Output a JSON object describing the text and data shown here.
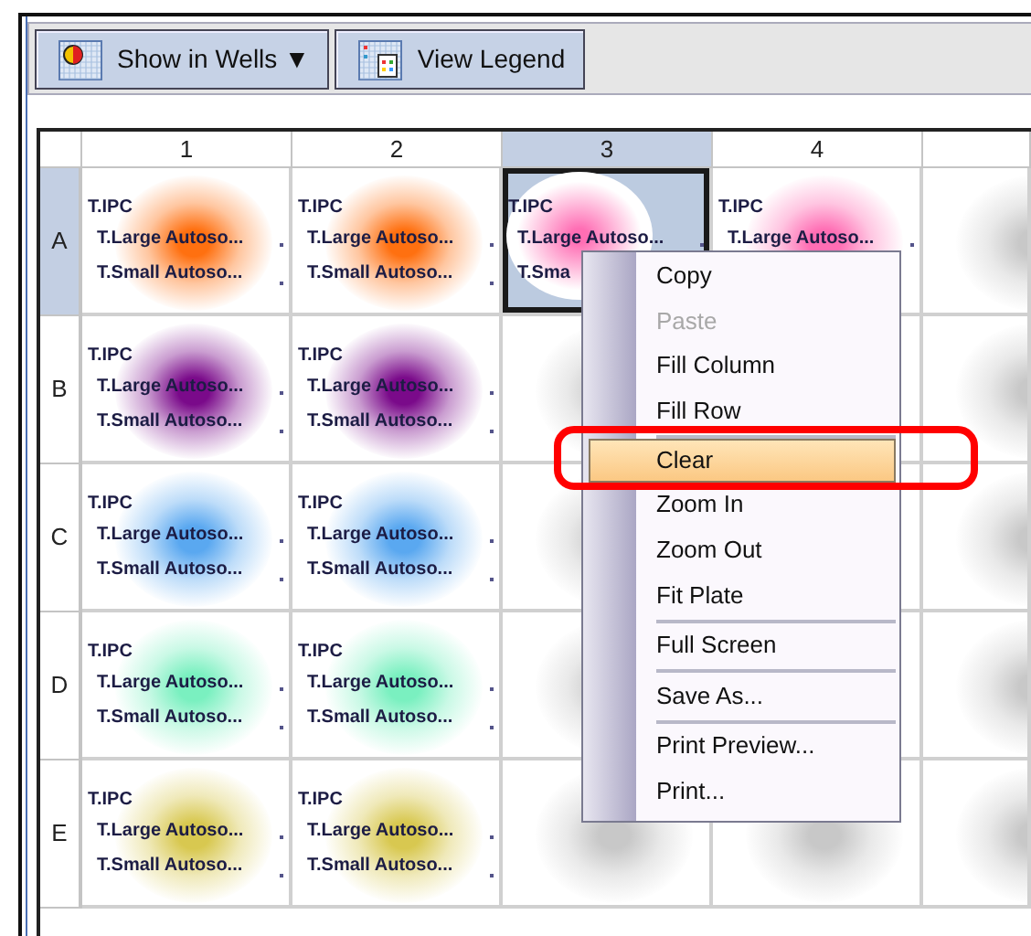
{
  "toolbar": {
    "buttons": [
      {
        "kind": "dropdown",
        "label": "Show in Wells",
        "caret": "▼"
      },
      {
        "kind": "legend",
        "label": "View Legend"
      }
    ]
  },
  "plate": {
    "columns": [
      {
        "label": "1",
        "selected": false
      },
      {
        "label": "2",
        "selected": false
      },
      {
        "label": "3",
        "selected": true
      },
      {
        "label": "4",
        "selected": false
      },
      {
        "selected": false
      }
    ],
    "rows": [
      {
        "label": "A",
        "selected": true,
        "wells": [
          {
            "color": "#ff7010",
            "selected": false,
            "lines": [
              "T.IPC",
              "T.Large Autoso...",
              "T.Small Autoso..."
            ]
          },
          {
            "color": "#ff7010",
            "selected": false,
            "lines": [
              "T.IPC",
              "T.Large Autoso...",
              "T.Small Autoso..."
            ]
          },
          {
            "color": "#ff6eb4",
            "selected": true,
            "lines": [
              "T.IPC",
              "T.Large Autoso...",
              "T.Sma"
            ]
          },
          {
            "color": "#ff6eb4",
            "selected": false,
            "lines": [
              "T.IPC",
              "T.Large Autoso..."
            ]
          },
          {
            "color": "#c8c8c8",
            "selected": false
          }
        ]
      },
      {
        "label": "B",
        "selected": false,
        "wells": [
          {
            "color": "#7a0a8a",
            "selected": false,
            "lines": [
              "T.IPC",
              "T.Large Autoso...",
              "T.Small Autoso..."
            ]
          },
          {
            "color": "#7a0a8a",
            "selected": false,
            "lines": [
              "T.IPC",
              "T.Large Autoso...",
              "T.Small Autoso..."
            ]
          },
          {
            "color": "#c8c8c8",
            "selected": false
          },
          {
            "selected": false
          },
          {
            "color": "#c8c8c8",
            "selected": false
          }
        ]
      },
      {
        "label": "C",
        "selected": false,
        "wells": [
          {
            "color": "#5aa8f0",
            "selected": false,
            "lines": [
              "T.IPC",
              "T.Large Autoso...",
              "T.Small Autoso..."
            ]
          },
          {
            "color": "#5aa8f0",
            "selected": false,
            "lines": [
              "T.IPC",
              "T.Large Autoso...",
              "T.Small Autoso..."
            ]
          },
          {
            "color": "#c8c8c8",
            "selected": false
          },
          {
            "selected": false
          },
          {
            "color": "#c8c8c8",
            "selected": false
          }
        ]
      },
      {
        "label": "D",
        "selected": false,
        "wells": [
          {
            "color": "#7af0c0",
            "selected": false,
            "lines": [
              "T.IPC",
              "T.Large Autoso...",
              "T.Small Autoso..."
            ]
          },
          {
            "color": "#7af0c0",
            "selected": false,
            "lines": [
              "T.IPC",
              "T.Large Autoso...",
              "T.Small Autoso..."
            ]
          },
          {
            "color": "#c8c8c8",
            "selected": false
          },
          {
            "selected": false
          },
          {
            "color": "#c8c8c8",
            "selected": false
          }
        ]
      },
      {
        "label": "E",
        "selected": false,
        "wells": [
          {
            "color": "#d8c850",
            "selected": false,
            "lines": [
              "T.IPC",
              "T.Large Autoso...",
              "T.Small Autoso..."
            ]
          },
          {
            "color": "#d8c850",
            "selected": false,
            "lines": [
              "T.IPC",
              "T.Large Autoso...",
              "T.Small Autoso..."
            ]
          },
          {
            "color": "#c8c8c8",
            "selected": false
          },
          {
            "color": "#c8c8c8",
            "selected": false
          },
          {
            "color": "#c8c8c8",
            "selected": false
          }
        ]
      }
    ]
  },
  "context_menu": {
    "items": [
      {
        "kind": "item",
        "label": "Copy",
        "disabled": false,
        "selected": false
      },
      {
        "kind": "item",
        "label": "Paste",
        "disabled": true,
        "selected": false
      },
      {
        "kind": "item",
        "label": "Fill Column",
        "disabled": false,
        "selected": false
      },
      {
        "kind": "item",
        "label": "Fill Row",
        "disabled": false,
        "selected": false
      },
      {
        "kind": "separator"
      },
      {
        "kind": "item",
        "label": "Clear",
        "disabled": false,
        "selected": true
      },
      {
        "kind": "item",
        "label": "Zoom In",
        "disabled": false,
        "selected": false
      },
      {
        "kind": "item",
        "label": "Zoom Out",
        "disabled": false,
        "selected": false
      },
      {
        "kind": "item",
        "label": "Fit Plate",
        "disabled": false,
        "selected": false
      },
      {
        "kind": "separator"
      },
      {
        "kind": "item",
        "label": "Full Screen",
        "disabled": false,
        "selected": false
      },
      {
        "kind": "separator"
      },
      {
        "kind": "item",
        "label": "Save As...",
        "disabled": false,
        "selected": false
      },
      {
        "kind": "separator"
      },
      {
        "kind": "item",
        "label": "Print Preview...",
        "disabled": false,
        "selected": false
      },
      {
        "kind": "item",
        "label": "Print...",
        "disabled": false,
        "selected": false
      }
    ]
  }
}
